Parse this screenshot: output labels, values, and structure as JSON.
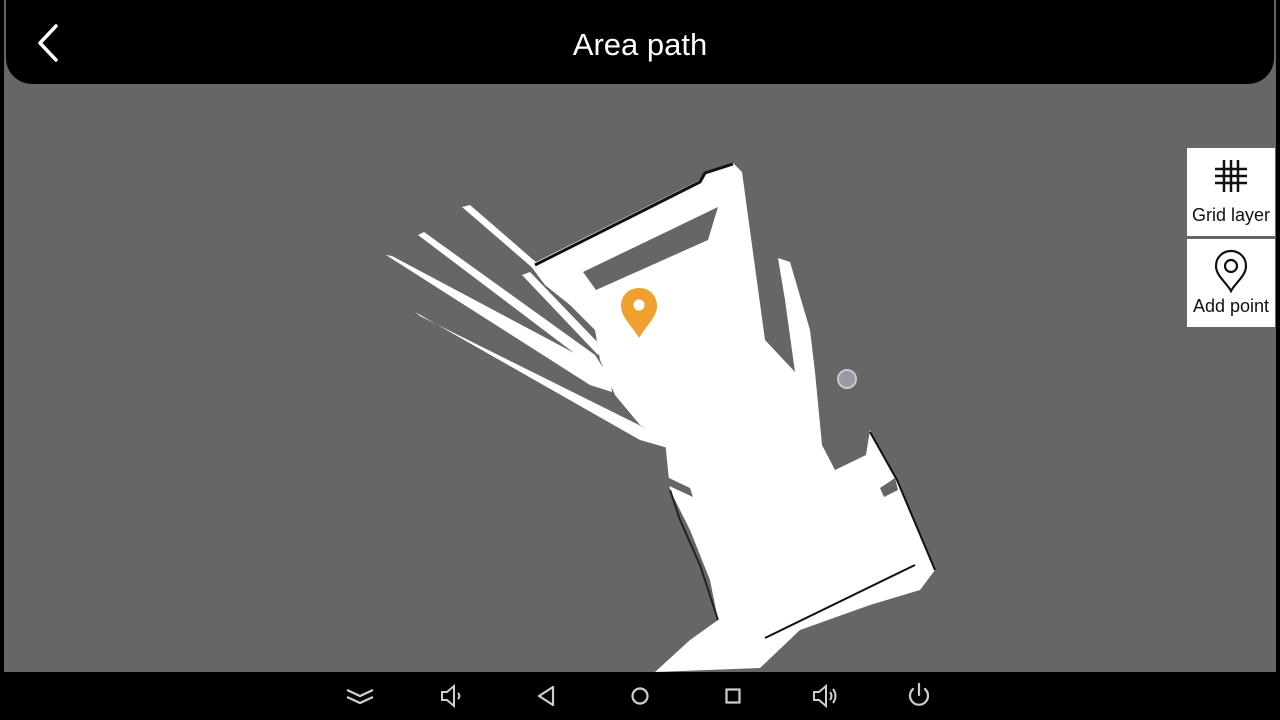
{
  "header": {
    "title": "Area path",
    "back_icon": "chevron-left-icon"
  },
  "side_panel": {
    "grid_layer": {
      "label": "Grid layer",
      "icon": "grid-icon"
    },
    "add_point": {
      "label": "Add point",
      "icon": "map-pin-outline-icon"
    }
  },
  "map": {
    "background_color": "#666666",
    "free_space_color": "#ffffff",
    "marker_color": "#f0a030",
    "marker_icon": "map-pin-icon",
    "robot_icon": "robot-position-icon"
  },
  "navbar": {
    "buttons": [
      {
        "icon": "collapse-chevrons-icon"
      },
      {
        "icon": "volume-down-icon"
      },
      {
        "icon": "back-triangle-icon"
      },
      {
        "icon": "home-circle-icon"
      },
      {
        "icon": "recents-square-icon"
      },
      {
        "icon": "volume-up-icon"
      },
      {
        "icon": "power-icon"
      }
    ]
  }
}
